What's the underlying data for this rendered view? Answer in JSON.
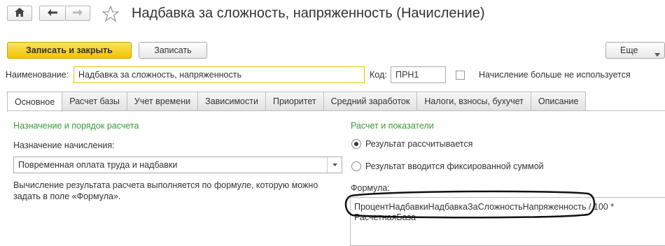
{
  "title": "Надбавка за сложность, напряженность (Начисление)",
  "toolbar": {
    "save_close_label": "Записать и закрыть",
    "save_label": "Записать",
    "more_label": "Еще"
  },
  "form": {
    "name_label": "Наименование:",
    "name_value": "Надбавка за сложность, напряженность",
    "code_label": "Код:",
    "code_value": "ПРН1",
    "unused_label": "Начисление больше не используется"
  },
  "tabs": [
    "Основное",
    "Расчет базы",
    "Учет времени",
    "Зависимости",
    "Приоритет",
    "Средний заработок",
    "Налоги, взносы, бухучет",
    "Описание"
  ],
  "left": {
    "section_title": "Назначение и порядок расчета",
    "purpose_label": "Назначение начисления:",
    "purpose_value": "Повременная оплата труда и надбавки",
    "description": "Вычисление результата расчета выполняется по формуле, которую можно задать в поле «Формула»."
  },
  "right": {
    "section_title": "Расчет и показатели",
    "radio_calculated": "Результат рассчитывается",
    "radio_fixed": "Результат вводится фиксированной суммой",
    "formula_label": "Формула:",
    "formula_line1_highlight": "ПроцентНадбавкиНадбавкаЗаСложностьНапряженность",
    "formula_line1_rest": " / 100 *",
    "formula_line2": "РасчетнаяБаза"
  }
}
